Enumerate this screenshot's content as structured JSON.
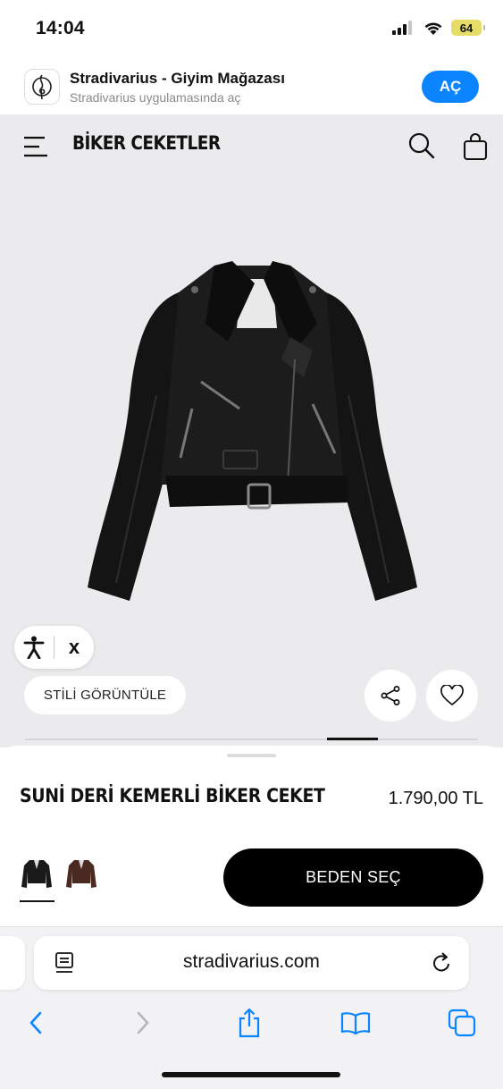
{
  "status_bar": {
    "time": "14:04",
    "battery_level": "64",
    "icons": [
      "signal-icon",
      "wifi-icon",
      "battery-icon"
    ]
  },
  "app_banner": {
    "name": "Stradivarius - Giyim Mağazası",
    "subtitle": "Stradivarius uygulamasında aç",
    "open_label": "AÇ",
    "accent_color": "#0a84ff"
  },
  "header": {
    "title": "BİKER CEKETLER",
    "icons": [
      "menu-icon",
      "search-icon",
      "shopping-bag-icon"
    ]
  },
  "gallery": {
    "style_button": "STİLİ GÖRÜNTÜLE",
    "accessibility_close": "x",
    "background": "#ebebed"
  },
  "product": {
    "name": "SUNİ DERİ KEMERLİ BİKER CEKET",
    "price": "1.790,00 TL",
    "colors": [
      "black",
      "brown"
    ],
    "selected_color": "black",
    "size_button": "BEDEN SEÇ"
  },
  "browser": {
    "url": "stradivarius.com",
    "toolbar_icons": [
      "back-icon",
      "forward-icon",
      "share-icon",
      "bookmarks-icon",
      "tabs-icon"
    ]
  }
}
